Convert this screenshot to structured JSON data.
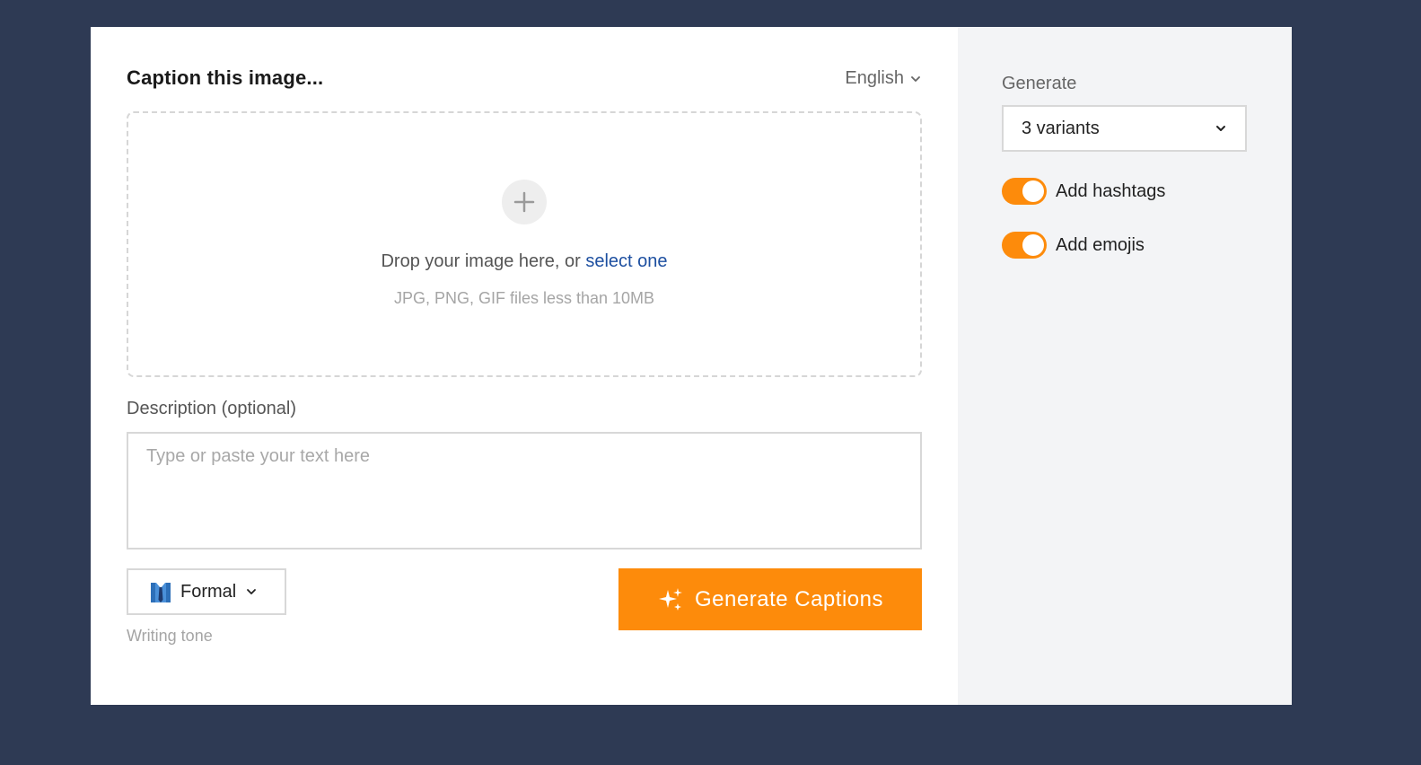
{
  "header": {
    "title": "Caption this image...",
    "language": "English"
  },
  "dropzone": {
    "text": "Drop your image here, or ",
    "link": "select one",
    "hint": "JPG, PNG, GIF files less than 10MB"
  },
  "description": {
    "label": "Description (optional)",
    "placeholder": "Type or paste your text here",
    "value": ""
  },
  "tone": {
    "value": "Formal",
    "icon": "necktie-shirt-icon",
    "label": "Writing tone"
  },
  "generate_button": {
    "label": "Generate Captions",
    "icon": "sparkles-icon"
  },
  "sidebar": {
    "generate_label": "Generate",
    "variants_value": "3 variants",
    "hashtags_label": "Add hashtags",
    "hashtags_on": true,
    "emojis_label": "Add emojis",
    "emojis_on": true
  },
  "colors": {
    "accent": "#fd8b0b",
    "link": "#1d4fa0",
    "background": "#2e3a54",
    "sidebar_bg": "#f3f4f6"
  }
}
